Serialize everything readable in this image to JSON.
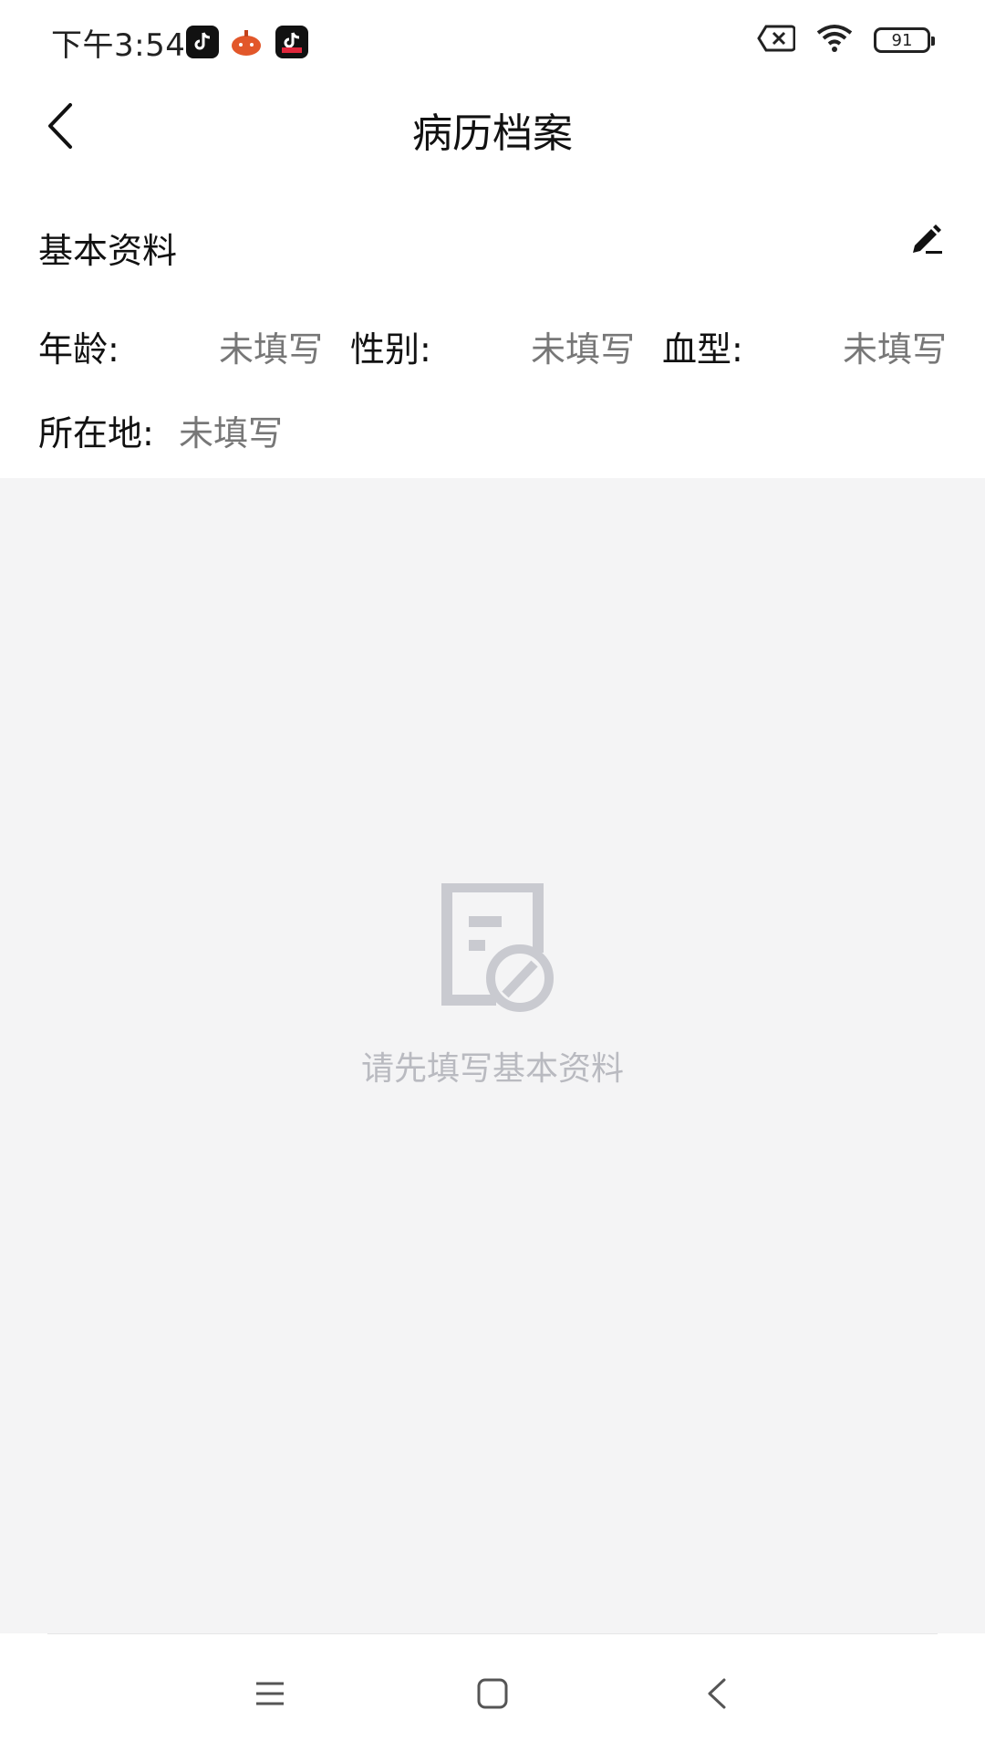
{
  "status_bar": {
    "time": "下午3:54",
    "battery_level": "91",
    "icons": [
      "tiktok-icon",
      "pumpkin-app-icon",
      "tiktok-lite-icon",
      "sim-off-icon",
      "wifi-icon",
      "battery-icon"
    ]
  },
  "header": {
    "title": "病历档案",
    "back_icon": "chevron-left-icon"
  },
  "basic_info": {
    "title": "基本资料",
    "edit_icon": "edit-pen-icon",
    "fields": {
      "age": {
        "label": "年龄:",
        "value": "未填写"
      },
      "gender": {
        "label": "性别:",
        "value": "未填写"
      },
      "blood_type": {
        "label": "血型:",
        "value": "未填写"
      },
      "location": {
        "label": "所在地:",
        "value": "未填写"
      }
    }
  },
  "empty_state": {
    "icon": "document-disabled-icon",
    "message": "请先填写基本资料"
  },
  "nav_bar": {
    "icons": [
      "menu-icon",
      "home-square-icon",
      "back-triangle-icon"
    ]
  },
  "colors": {
    "content_bg": "#f4f4f5",
    "placeholder_text": "#777777",
    "empty_text": "#b9bac0",
    "empty_icon": "#c9cad0"
  }
}
